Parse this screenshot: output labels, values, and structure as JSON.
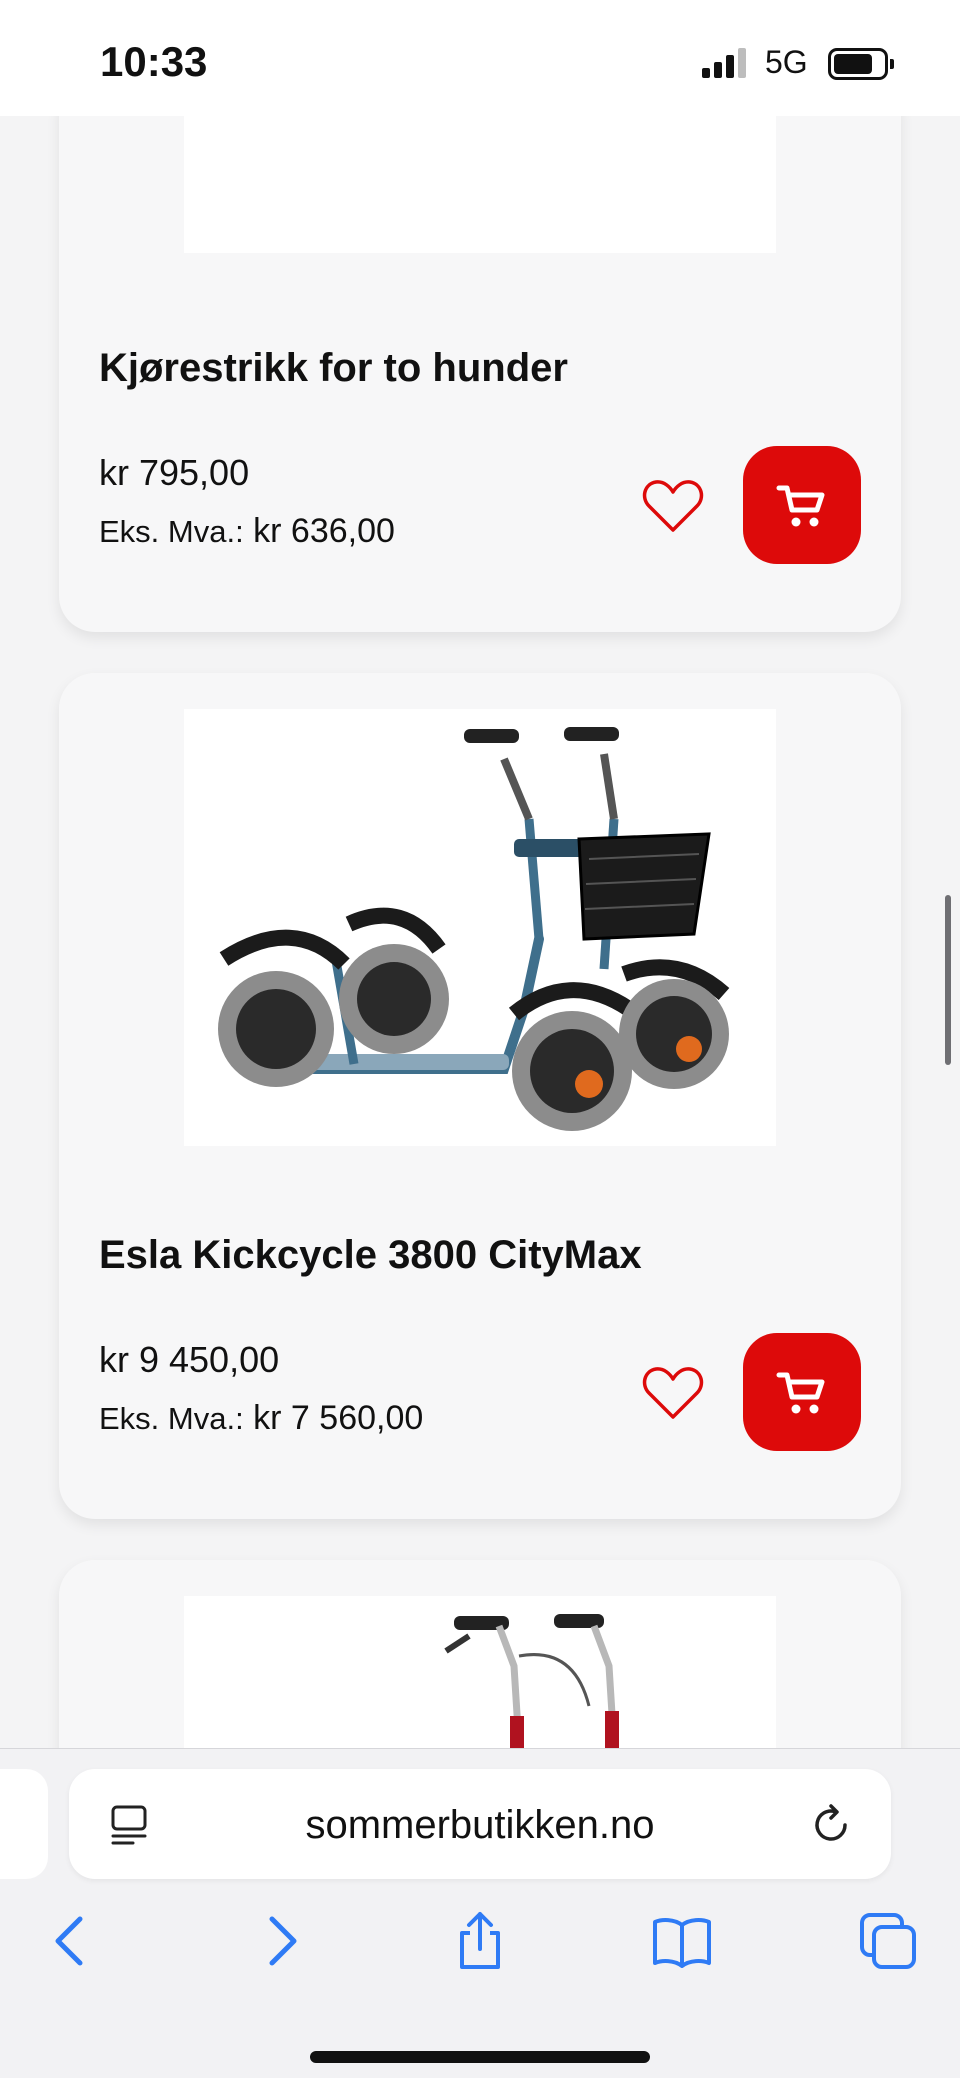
{
  "status_bar": {
    "time": "10:33",
    "network": "5G"
  },
  "products": [
    {
      "title": "Kjørestrikk for to hunder",
      "price": "kr 795,00",
      "vat_label": "Eks. Mva.:",
      "vat_price": "kr 636,00"
    },
    {
      "title": "Esla Kickcycle 3800 CityMax",
      "price": "kr 9 450,00",
      "vat_label": "Eks. Mva.:",
      "vat_price": "kr 7 560,00"
    }
  ],
  "colors": {
    "accent": "#dd0a0a",
    "link_blue": "#2f7bf5"
  },
  "icons": {
    "favorite": "heart-icon",
    "cart": "cart-icon",
    "reader": "reader-icon",
    "reload": "reload-icon"
  },
  "browser": {
    "address": "sommerbutikken.no",
    "toolbar": [
      "back",
      "forward",
      "share",
      "bookmarks",
      "tabs"
    ]
  }
}
